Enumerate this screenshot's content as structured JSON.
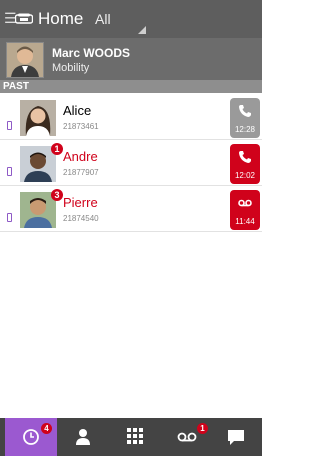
{
  "header": {
    "title": "Home",
    "filter": "All"
  },
  "profile": {
    "name": "Marc WOODS",
    "status": "Mobility"
  },
  "section_label": "PAST",
  "calls": [
    {
      "name": "Alice",
      "number": "21873461",
      "time": "12:28",
      "badge": "",
      "missed": false,
      "type": "call",
      "color": "#9a9a9a"
    },
    {
      "name": "Andre",
      "number": "21877907",
      "time": "12:02",
      "badge": "1",
      "missed": true,
      "type": "call",
      "color": "#d0021b"
    },
    {
      "name": "Pierre",
      "number": "21874540",
      "time": "11:44",
      "badge": "3",
      "missed": true,
      "type": "voicemail",
      "color": "#d0021b"
    }
  ],
  "tabs": [
    {
      "icon": "clock-icon",
      "badge": "4",
      "active": true
    },
    {
      "icon": "contacts-icon",
      "badge": "",
      "active": false
    },
    {
      "icon": "dialpad-icon",
      "badge": "",
      "active": false
    },
    {
      "icon": "voicemail-icon",
      "badge": "1",
      "active": false
    },
    {
      "icon": "chat-icon",
      "badge": "",
      "active": false
    }
  ],
  "colors": {
    "accent": "#9b59d0",
    "alert": "#d0021b",
    "topbar": "#5e5e5e",
    "bottombar": "#444444"
  }
}
